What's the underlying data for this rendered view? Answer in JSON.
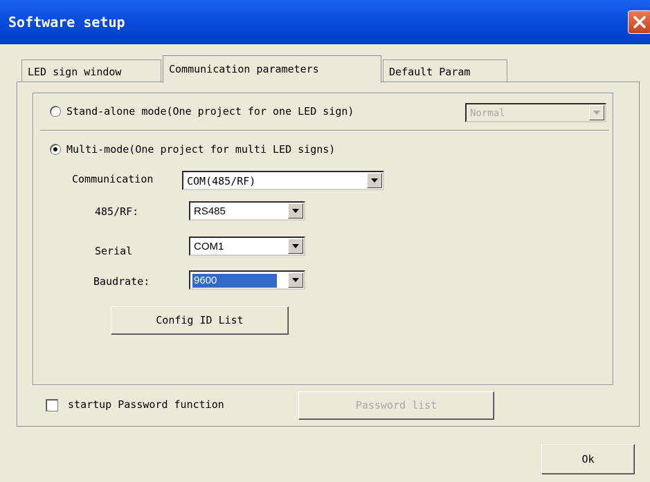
{
  "window": {
    "title": "Software setup"
  },
  "tabs": [
    {
      "label": "LED sign window"
    },
    {
      "label": "Communication parameters"
    },
    {
      "label": "Default Param"
    }
  ],
  "stand_alone": {
    "label": "Stand-alone mode(One project for one LED sign)",
    "selected": false,
    "mode_select": {
      "value": "Normal",
      "disabled": true
    }
  },
  "multi_mode": {
    "label": "Multi-mode(One project for multi LED signs)",
    "selected": true
  },
  "communication": {
    "label": "Communication",
    "value": "COM(485/RF)"
  },
  "rs485_rf": {
    "label": "485/RF:",
    "value": "RS485"
  },
  "serial": {
    "label": "Serial",
    "value": "COM1"
  },
  "baudrate": {
    "label": "Baudrate:",
    "value": "9600"
  },
  "config_id_list_button": {
    "label": "Config ID List"
  },
  "password": {
    "checkbox_label": "startup Password function",
    "checked": false,
    "list_button_label": "Password list"
  },
  "ok_button": {
    "label": "Ok"
  }
}
